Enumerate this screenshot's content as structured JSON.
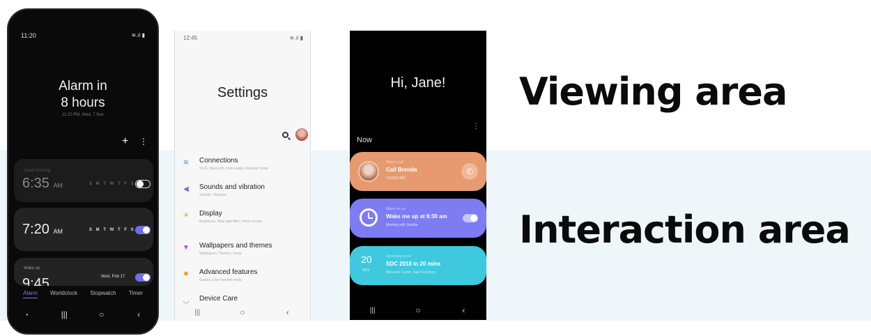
{
  "labels": {
    "viewing": "Viewing area",
    "interaction": "Interaction area"
  },
  "clock_app": {
    "status_time": "11:20",
    "status_icons": "≋.ıl ▮",
    "title_line1": "Alarm in",
    "title_line2": "8 hours",
    "subtitle": "11:20 PM, Wed, 7 Nov",
    "add_icon": "+",
    "more_icon": "⋮",
    "alarms": [
      {
        "label": "Good morning",
        "time": "6:35",
        "ampm": "AM",
        "days": "S M T W T F S",
        "enabled": false
      },
      {
        "label": "",
        "time": "7:20",
        "ampm": "AM",
        "days": "S M T W T F S",
        "enabled": true
      },
      {
        "label": "Wake up",
        "time": "9:45",
        "ampm": "",
        "days": "Wed, Feb 17",
        "enabled": true
      }
    ],
    "tabs": [
      "Alarm",
      "Worldclock",
      "Stopwatch",
      "Timer"
    ],
    "active_tab": "Alarm",
    "nav": {
      "dot": "•",
      "recent": "|||",
      "home": "○",
      "back": "‹"
    }
  },
  "settings_app": {
    "status_time": "12:45",
    "status_icons": "≋.ıl ▮",
    "title": "Settings",
    "items": [
      {
        "name": "Connections",
        "desc": "Wi-Fi, Bluetooth, Data usage, Airplane mode",
        "icon": "wifi-icon",
        "color": "#3a8ee6"
      },
      {
        "name": "Sounds and vibration",
        "desc": "Sounds, Vibration",
        "icon": "speaker-icon",
        "color": "#6f6ee8"
      },
      {
        "name": "Display",
        "desc": "Brightness, Blue light filter, Home screen",
        "icon": "brightness-icon",
        "color": "#8cc43a"
      },
      {
        "name": "Wallpapers and themes",
        "desc": "Wallpapers, Themes, Icons",
        "icon": "brush-icon",
        "color": "#b14ad9"
      },
      {
        "name": "Advanced features",
        "desc": "Games, One-handed mode",
        "icon": "gear-icon",
        "color": "#f0a020"
      },
      {
        "name": "Device Care",
        "desc": "",
        "icon": "care-icon",
        "color": "#2fb58c"
      }
    ],
    "nav": {
      "recent": "|||",
      "home": "○",
      "back": "‹"
    }
  },
  "bixby_app": {
    "greeting": "Hi, Jane!",
    "more_icon": "⋮",
    "section": "Now",
    "cards": [
      {
        "small": "Make a call",
        "title": "Call Brenda",
        "sub": "1234567890",
        "color": "#e79a70"
      },
      {
        "small": "Wake me up",
        "title": "Wake me up at 6:30 am",
        "sub": "Meeting with Sandra",
        "color": "#7d7cf3"
      },
      {
        "small": "Upcoming event",
        "title": "SDC 2018 in 20 mins",
        "sub": "Moscone Center, San Francisco",
        "date": "20",
        "date_sub": "NOV",
        "color": "#3ec9de"
      }
    ],
    "call_icon": "✆",
    "nav": {
      "recent": "|||",
      "home": "○",
      "back": "‹"
    }
  }
}
